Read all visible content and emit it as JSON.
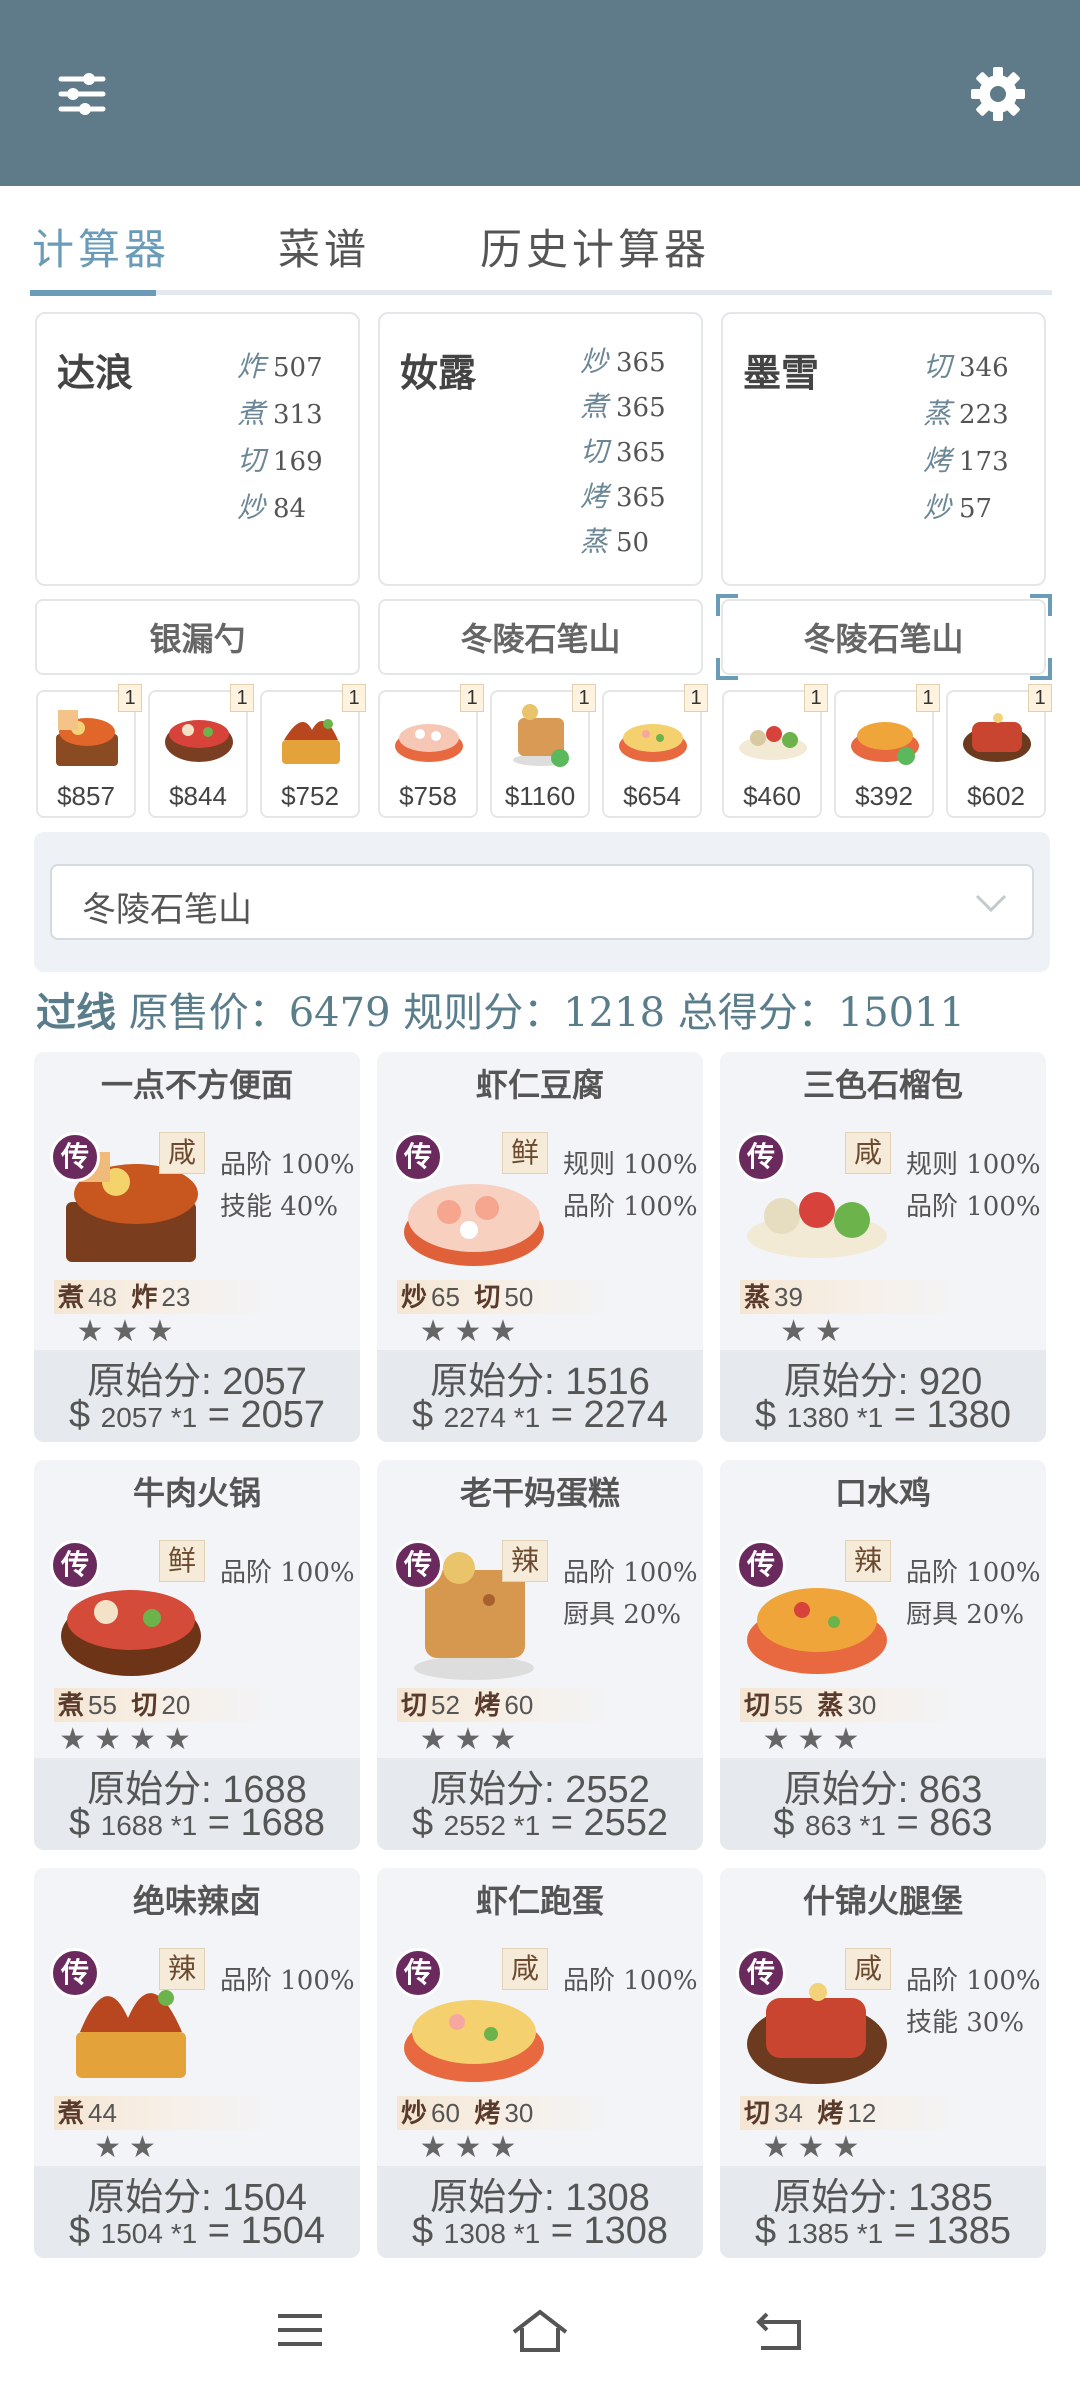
{
  "appbar": {
    "filter_icon": "sliders-icon",
    "settings_icon": "gear-icon",
    "bg": "#5f7a89"
  },
  "tabs": [
    {
      "label": "计算器"
    },
    {
      "label": "菜谱"
    },
    {
      "label": "历史计算器"
    }
  ],
  "chefs": [
    {
      "name": "达浪",
      "skills": [
        {
          "k": "炸",
          "v": "507"
        },
        {
          "k": "煮",
          "v": "313"
        },
        {
          "k": "切",
          "v": "169"
        },
        {
          "k": "炒",
          "v": "84"
        }
      ]
    },
    {
      "name": "奻露",
      "skills": [
        {
          "k": "炒",
          "v": "365"
        },
        {
          "k": "煮",
          "v": "365"
        },
        {
          "k": "切",
          "v": "365"
        },
        {
          "k": "烤",
          "v": "365"
        },
        {
          "k": "蒸",
          "v": "50"
        }
      ]
    },
    {
      "name": "墨雪",
      "skills": [
        {
          "k": "切",
          "v": "346"
        },
        {
          "k": "蒸",
          "v": "223"
        },
        {
          "k": "烤",
          "v": "173"
        },
        {
          "k": "炒",
          "v": "57"
        }
      ]
    }
  ],
  "equipment": [
    "银漏勺",
    "冬陵石笔山",
    "冬陵石笔山"
  ],
  "dishes": [
    {
      "price": "$857",
      "qty": "1"
    },
    {
      "price": "$844",
      "qty": "1"
    },
    {
      "price": "$752",
      "qty": "1"
    },
    {
      "price": "$758",
      "qty": "1"
    },
    {
      "price": "$1160",
      "qty": "1"
    },
    {
      "price": "$654",
      "qty": "1"
    },
    {
      "price": "$460",
      "qty": "1"
    },
    {
      "price": "$392",
      "qty": "1"
    },
    {
      "price": "$602",
      "qty": "1"
    }
  ],
  "select": {
    "value": "冬陵石笔山"
  },
  "summary": {
    "status": "过线",
    "text": "原售价：6479 规则分：1218 总得分：15011"
  },
  "cards": [
    {
      "title": "一点不方便面",
      "rarity": "传",
      "flavor": "咸",
      "bonus": [
        "品阶 100%",
        "技能 40%"
      ],
      "req": [
        {
          "k": "煮",
          "v": "48"
        },
        {
          "k": "炸",
          "v": "23"
        }
      ],
      "stars": "★★★",
      "score_label": "原始分",
      "score": ": 2057",
      "calc": "2057 *1",
      "total": "= 2057"
    },
    {
      "title": "虾仁豆腐",
      "rarity": "传",
      "flavor": "鲜",
      "bonus": [
        "规则 100%",
        "品阶 100%"
      ],
      "req": [
        {
          "k": "炒",
          "v": "65"
        },
        {
          "k": "切",
          "v": "50"
        }
      ],
      "stars": "★★★",
      "score_label": "原始分",
      "score": ": 1516",
      "calc": "2274 *1",
      "total": "= 2274"
    },
    {
      "title": "三色石榴包",
      "rarity": "传",
      "flavor": "咸",
      "bonus": [
        "规则 100%",
        "品阶 100%"
      ],
      "req": [
        {
          "k": "蒸",
          "v": "39"
        }
      ],
      "stars": "★★",
      "score_label": "原始分",
      "score": ": 920",
      "calc": "1380 *1",
      "total": "= 1380"
    },
    {
      "title": "牛肉火锅",
      "rarity": "传",
      "flavor": "鲜",
      "bonus": [
        "品阶 100%"
      ],
      "req": [
        {
          "k": "煮",
          "v": "55"
        },
        {
          "k": "切",
          "v": "20"
        }
      ],
      "stars": "★★★★",
      "score_label": "原始分",
      "score": ": 1688",
      "calc": "1688 *1",
      "total": "= 1688"
    },
    {
      "title": "老干妈蛋糕",
      "rarity": "传",
      "flavor": "辣",
      "bonus": [
        "品阶 100%",
        "厨具 20%"
      ],
      "req": [
        {
          "k": "切",
          "v": "52"
        },
        {
          "k": "烤",
          "v": "60"
        }
      ],
      "stars": "★★★",
      "score_label": "原始分",
      "score": ": 2552",
      "calc": "2552 *1",
      "total": "= 2552"
    },
    {
      "title": "口水鸡",
      "rarity": "传",
      "flavor": "辣",
      "bonus": [
        "品阶 100%",
        "厨具 20%"
      ],
      "req": [
        {
          "k": "切",
          "v": "55"
        },
        {
          "k": "蒸",
          "v": "30"
        }
      ],
      "stars": "★★★",
      "score_label": "原始分",
      "score": ": 863",
      "calc": "863 *1",
      "total": "= 863"
    },
    {
      "title": "绝味辣卤",
      "rarity": "传",
      "flavor": "辣",
      "bonus": [
        "品阶 100%"
      ],
      "req": [
        {
          "k": "煮",
          "v": "44"
        }
      ],
      "stars": "★★",
      "score_label": "原始分",
      "score": ": 1504",
      "calc": "1504 *1",
      "total": "= 1504"
    },
    {
      "title": "虾仁跑蛋",
      "rarity": "传",
      "flavor": "咸",
      "bonus": [
        "品阶 100%"
      ],
      "req": [
        {
          "k": "炒",
          "v": "60"
        },
        {
          "k": "烤",
          "v": "30"
        }
      ],
      "stars": "★★★",
      "score_label": "原始分",
      "score": ": 1308",
      "calc": "1308 *1",
      "total": "= 1308"
    },
    {
      "title": "什锦火腿堡",
      "rarity": "传",
      "flavor": "咸",
      "bonus": [
        "品阶 100%",
        "技能 30%"
      ],
      "req": [
        {
          "k": "切",
          "v": "34"
        },
        {
          "k": "烤",
          "v": "12"
        }
      ],
      "stars": "★★★",
      "score_label": "原始分",
      "score": ": 1385",
      "calc": "1385 *1",
      "total": "= 1385"
    }
  ],
  "currency": "$",
  "navbar": [
    "menu-icon",
    "home-icon",
    "back-icon"
  ]
}
